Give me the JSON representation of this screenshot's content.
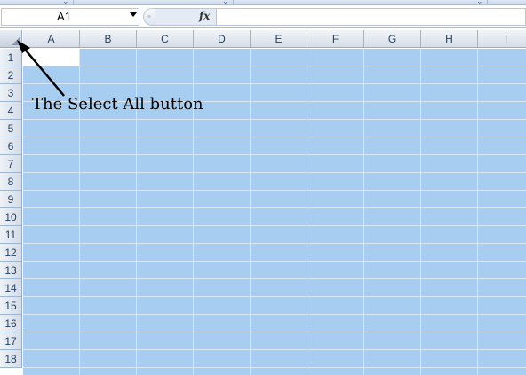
{
  "formula_bar": {
    "name_box_value": "A1",
    "fx_label": "fx",
    "formula_value": ""
  },
  "grid": {
    "columns": [
      "A",
      "B",
      "C",
      "D",
      "E",
      "F",
      "G",
      "H",
      "I"
    ],
    "rows": [
      "1",
      "2",
      "3",
      "4",
      "5",
      "6",
      "7",
      "8",
      "9",
      "10",
      "11",
      "12",
      "13",
      "14",
      "15",
      "16",
      "17",
      "18"
    ],
    "selection_color": "#a7cdf0",
    "active_cell": "A1"
  },
  "annotation": {
    "text": "The Select All button",
    "target": "select-all-button"
  }
}
